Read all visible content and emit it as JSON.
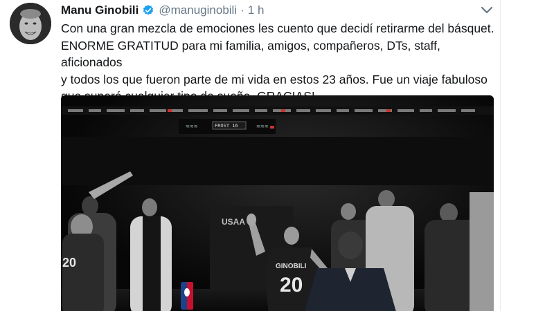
{
  "tweet": {
    "display_name": "Manu Ginobili",
    "handle": "@manuginobili",
    "separator": "·",
    "time": "1 h",
    "text": "Con una gran mezcla de emociones les cuento que decidí retirarme del básquet.\nENORME GRATITUD para mi familia, amigos, compañeros, DTs, staff, aficionados\ny todos los que fueron parte de mi vida en estos 23 años. Fue un viaje fabuloso\nque superó cualquier tipo de sueño. GRACIAS!",
    "icons": {
      "verified": "verified-badge-icon",
      "menu": "chevron-down-icon"
    },
    "colors": {
      "verified_blue": "#1da1f2",
      "name": "#14171a",
      "secondary": "#657786"
    }
  },
  "photo": {
    "jersey_name": "GINOBILI",
    "jersey_number": "20",
    "scoreboard_text_left": "≋≋≋",
    "scoreboard_center": "FROST 16",
    "scoreboard_text_right": "≋≋≋",
    "tunnel_sign": "USAA"
  }
}
